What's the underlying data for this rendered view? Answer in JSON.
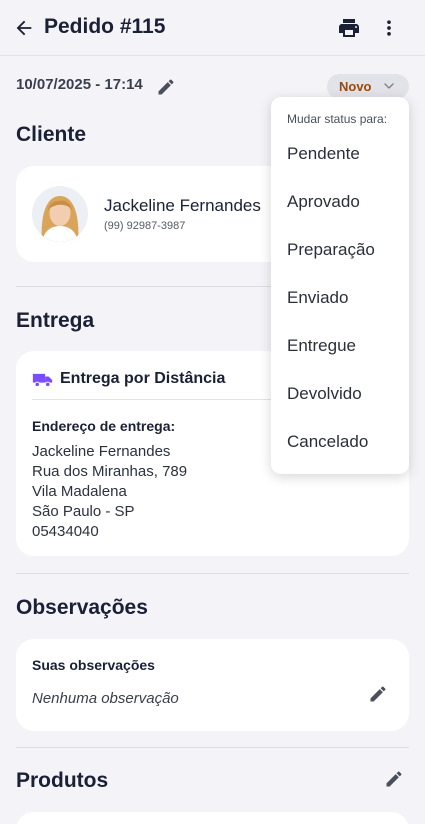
{
  "header": {
    "title": "Pedido #115",
    "back_icon": "arrow-left-icon",
    "print_icon": "printer-icon",
    "more_icon": "more-vertical-icon"
  },
  "order": {
    "datetime": "10/07/2025 - 17:14",
    "status": "Novo",
    "status_color": "#9a4a0a"
  },
  "client": {
    "section_title": "Cliente",
    "name": "Jackeline Fernandes",
    "phone": "(99) 92987-3987"
  },
  "delivery": {
    "section_title": "Entrega",
    "method": "Entrega por Distância",
    "address_label": "Endereço de entrega:",
    "address_lines": [
      "Jackeline Fernandes",
      "Rua dos Miranhas, 789",
      "Vila Madalena",
      "São Paulo - SP",
      "05434040"
    ]
  },
  "notes": {
    "section_title": "Observações",
    "label": "Suas observações",
    "empty_text": "Nenhuma observação"
  },
  "products": {
    "section_title": "Produtos"
  },
  "status_menu": {
    "header": "Mudar status para:",
    "items": [
      "Pendente",
      "Aprovado",
      "Preparação",
      "Enviado",
      "Entregue",
      "Devolvido",
      "Cancelado"
    ]
  },
  "colors": {
    "accent": "#7c4dff",
    "background": "#f4f4f8"
  }
}
